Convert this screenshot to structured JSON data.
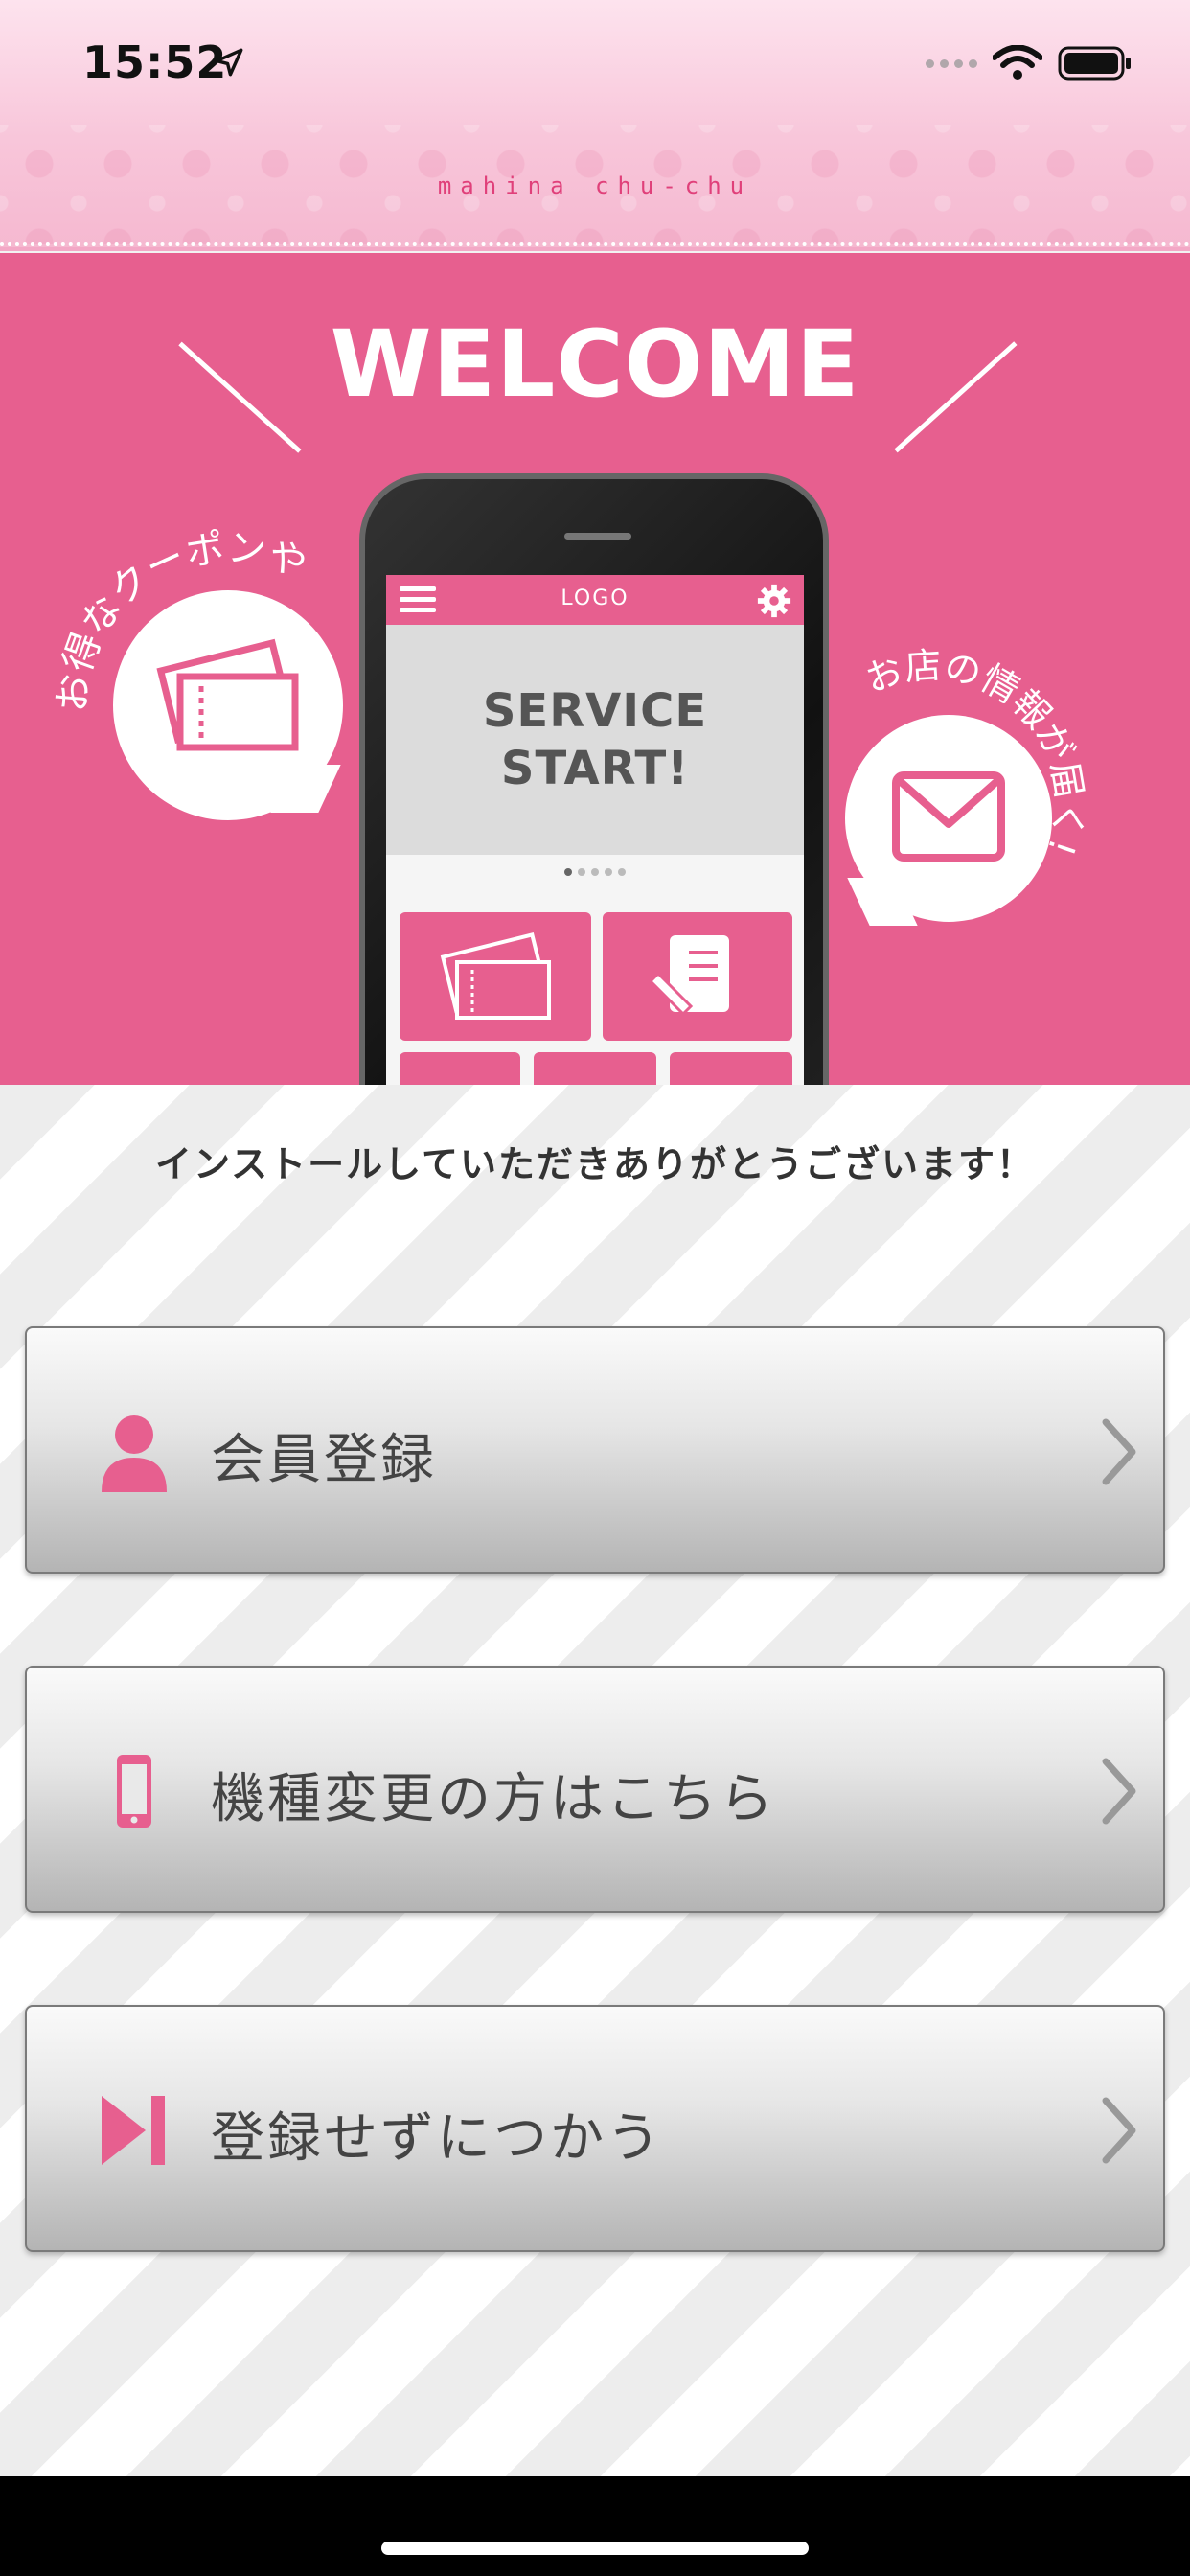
{
  "status_bar": {
    "time": "15:52",
    "location_icon": "location-arrow-icon",
    "signal_icon": "signal-dots-icon",
    "wifi_icon": "wifi-icon",
    "battery_icon": "battery-icon"
  },
  "header": {
    "brand": "mahina chu-chu"
  },
  "banner": {
    "title": "WELCOME",
    "left_caption": "お得なクーポンや",
    "right_caption": "お店の情報が届く!",
    "left_icon": "coupon-ticket-icon",
    "right_icon": "envelope-icon",
    "phone": {
      "logo": "LOGO",
      "hero_line_1": "SERVICE",
      "hero_line_2": "START!",
      "menu_icon": "hamburger-menu-icon",
      "settings_icon": "gear-icon"
    }
  },
  "main": {
    "thanks_message": "インストールしていただきありがとうございます！",
    "buttons": [
      {
        "label": "会員登録",
        "icon": "person-icon"
      },
      {
        "label": "機種変更の方はこちら",
        "icon": "smartphone-icon"
      },
      {
        "label": "登録せずにつかう",
        "icon": "skip-forward-icon"
      }
    ]
  },
  "colors": {
    "accent": "#e75f8f",
    "header_pink": "#f8c6da",
    "text_dark": "#444444"
  }
}
